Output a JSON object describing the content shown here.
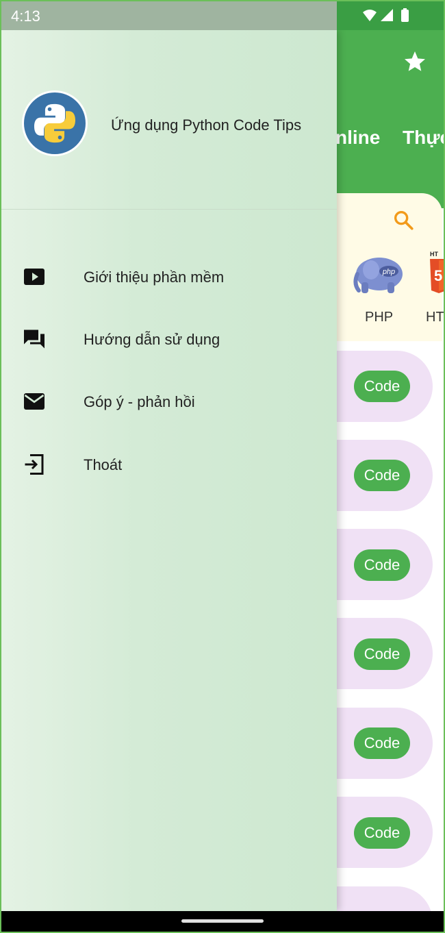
{
  "status": {
    "time": "4:13"
  },
  "app_bar": {
    "tab_partial_1": "nline",
    "tab_partial_2": "Thực"
  },
  "languages": [
    {
      "label": "PHP"
    },
    {
      "label": "HT"
    }
  ],
  "code_button_label": "Code",
  "drawer": {
    "app_name": "Ứng dụng Python Code Tips",
    "items": [
      {
        "label": "Giới thiệu phần mềm",
        "icon": "play-icon"
      },
      {
        "label": "Hướng dẫn sử dụng",
        "icon": "forum-icon"
      },
      {
        "label": "Góp ý - phản hồi",
        "icon": "mail-icon"
      },
      {
        "label": "Thoát",
        "icon": "exit-icon"
      }
    ]
  },
  "colors": {
    "accent_green": "#4caf50",
    "card_lilac": "#f0e1f5",
    "drawer_bg": "#d4ebd6"
  }
}
